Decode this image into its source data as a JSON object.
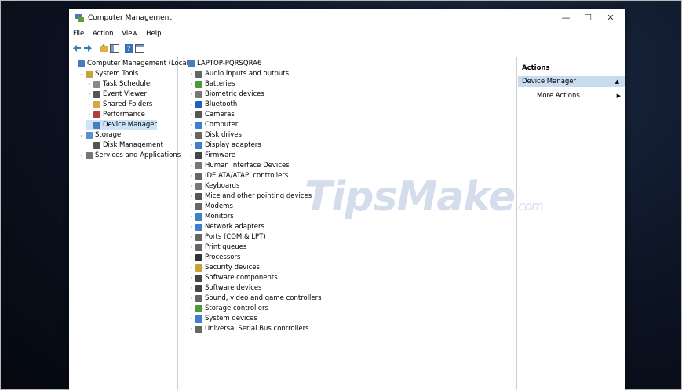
{
  "window": {
    "title": "Computer Management",
    "menu": [
      "File",
      "Action",
      "View",
      "Help"
    ]
  },
  "left_tree": [
    {
      "label": "Computer Management (Local)",
      "icon": "computer-management-icon",
      "color": "#4a7bc0",
      "level": 0,
      "chev": "",
      "selected": false
    },
    {
      "label": "System Tools",
      "icon": "tools-icon",
      "color": "#c9a23a",
      "level": 1,
      "chev": "⌄",
      "selected": false
    },
    {
      "label": "Task Scheduler",
      "icon": "clock-icon",
      "color": "#888888",
      "level": 2,
      "chev": "›",
      "selected": false
    },
    {
      "label": "Event Viewer",
      "icon": "event-viewer-icon",
      "color": "#555555",
      "level": 2,
      "chev": "›",
      "selected": false
    },
    {
      "label": "Shared Folders",
      "icon": "shared-folder-icon",
      "color": "#d9a441",
      "level": 2,
      "chev": "›",
      "selected": false
    },
    {
      "label": "Performance",
      "icon": "performance-icon",
      "color": "#b04040",
      "level": 2,
      "chev": "›",
      "selected": false
    },
    {
      "label": "Device Manager",
      "icon": "device-manager-icon",
      "color": "#4a7bc0",
      "level": 2,
      "chev": "",
      "selected": true
    },
    {
      "label": "Storage",
      "icon": "storage-icon",
      "color": "#5a8fcf",
      "level": 1,
      "chev": "⌄",
      "selected": false
    },
    {
      "label": "Disk Management",
      "icon": "disk-management-icon",
      "color": "#555555",
      "level": 2,
      "chev": "",
      "selected": false
    },
    {
      "label": "Services and Applications",
      "icon": "services-icon",
      "color": "#777777",
      "level": 1,
      "chev": "›",
      "selected": false
    }
  ],
  "device_root": {
    "label": "LAPTOP-PQRSQRA6",
    "icon": "laptop-icon",
    "color": "#4a7bc0"
  },
  "devices": [
    {
      "label": "Audio inputs and outputs",
      "icon": "audio-icon",
      "color": "#666666"
    },
    {
      "label": "Batteries",
      "icon": "battery-icon",
      "color": "#4c9a3a"
    },
    {
      "label": "Biometric devices",
      "icon": "biometric-icon",
      "color": "#777777"
    },
    {
      "label": "Bluetooth",
      "icon": "bluetooth-icon",
      "color": "#1f5fbf"
    },
    {
      "label": "Cameras",
      "icon": "camera-icon",
      "color": "#555555"
    },
    {
      "label": "Computer",
      "icon": "computer-icon",
      "color": "#3d7fc9"
    },
    {
      "label": "Disk drives",
      "icon": "disk-drive-icon",
      "color": "#666666"
    },
    {
      "label": "Display adapters",
      "icon": "display-adapter-icon",
      "color": "#3d7fc9"
    },
    {
      "label": "Firmware",
      "icon": "firmware-icon",
      "color": "#444444"
    },
    {
      "label": "Human Interface Devices",
      "icon": "hid-icon",
      "color": "#777777"
    },
    {
      "label": "IDE ATA/ATAPI controllers",
      "icon": "ide-controller-icon",
      "color": "#666666"
    },
    {
      "label": "Keyboards",
      "icon": "keyboard-icon",
      "color": "#777777"
    },
    {
      "label": "Mice and other pointing devices",
      "icon": "mouse-icon",
      "color": "#555555"
    },
    {
      "label": "Modems",
      "icon": "modem-icon",
      "color": "#666666"
    },
    {
      "label": "Monitors",
      "icon": "monitor-icon",
      "color": "#3d7fc9"
    },
    {
      "label": "Network adapters",
      "icon": "network-adapter-icon",
      "color": "#3d7fc9"
    },
    {
      "label": "Ports (COM & LPT)",
      "icon": "port-icon",
      "color": "#666666"
    },
    {
      "label": "Print queues",
      "icon": "printer-icon",
      "color": "#666666"
    },
    {
      "label": "Processors",
      "icon": "processor-icon",
      "color": "#333333"
    },
    {
      "label": "Security devices",
      "icon": "security-device-icon",
      "color": "#c9a23a"
    },
    {
      "label": "Software components",
      "icon": "software-component-icon",
      "color": "#444444"
    },
    {
      "label": "Software devices",
      "icon": "software-device-icon",
      "color": "#444444"
    },
    {
      "label": "Sound, video and game controllers",
      "icon": "sound-icon",
      "color": "#666666"
    },
    {
      "label": "Storage controllers",
      "icon": "storage-controller-icon",
      "color": "#4c9a3a"
    },
    {
      "label": "System devices",
      "icon": "system-device-icon",
      "color": "#3d7fc9"
    },
    {
      "label": "Universal Serial Bus controllers",
      "icon": "usb-icon",
      "color": "#666666"
    }
  ],
  "actions": {
    "title": "Actions",
    "section": "Device Manager",
    "more": "More Actions"
  },
  "watermark": {
    "main": "TipsMake",
    "suffix": ".com"
  }
}
